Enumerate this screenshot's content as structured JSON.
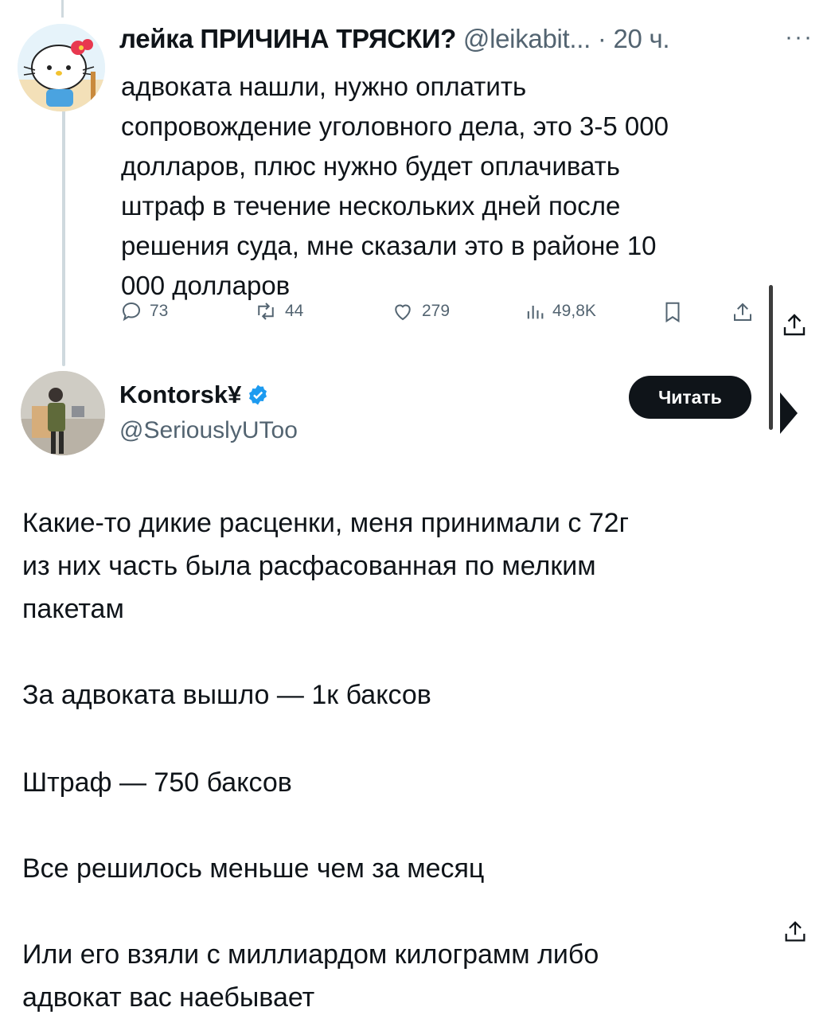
{
  "tweet1": {
    "display_name": "лейка ПРИЧИНА ТРЯСКИ?",
    "handle": "@leikabit...",
    "separator": " · ",
    "time": "20 ч.",
    "more": "···",
    "lines": [
      "адвоката нашли, нужно оплатить",
      "сопровождение уголовного дела, это 3-5 000",
      "долларов, плюс нужно будет оплачивать",
      "штраф в течение нескольких дней после",
      "решения суда, мне сказали это в районе 10",
      "000 долларов"
    ],
    "stats": {
      "replies": "73",
      "reposts": "44",
      "likes": "279",
      "views": "49,8K"
    }
  },
  "tweet2": {
    "display_name": "Kontorsk¥",
    "handle": "@SeriouslyUToo",
    "follow_label": "Читать",
    "paragraphs": [
      [
        "Какие-то дикие расценки, меня принимали с 72г",
        "из них часть была расфасованная по мелким",
        "пакетам"
      ],
      [
        "За адвоката вышло — 1к баксов"
      ],
      [
        "Штраф — 750 баксов"
      ],
      [
        "Все решилось меньше чем за месяц"
      ],
      [
        "Или его взяли с миллиардом килограмм либо",
        "адвокат вас наебывает"
      ]
    ]
  },
  "colors": {
    "text": "#0f1419",
    "secondary": "#536471",
    "verified": "#1d9bf0",
    "thread_line": "#cfd9de"
  },
  "icons": [
    "reply-icon",
    "repost-icon",
    "like-icon",
    "views-icon",
    "bookmark-icon",
    "share-icon",
    "verified-badge-icon"
  ]
}
